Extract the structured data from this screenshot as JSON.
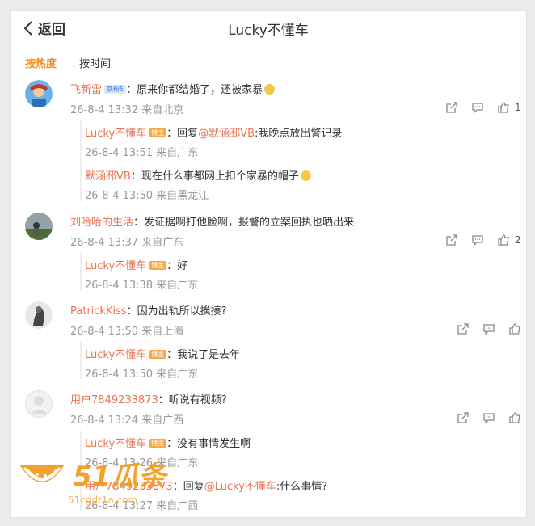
{
  "header": {
    "back_label": "返回",
    "title": "Lucky不懂车"
  },
  "tabs": [
    {
      "label": "按热度",
      "active": true
    },
    {
      "label": "按时间",
      "active": false
    }
  ],
  "comments": [
    {
      "user": "飞新雷",
      "badge": "铁粉5",
      "text": "：原来你都结婚了，还被家暴",
      "meta": "26-8-4 13:32 来自北京",
      "likes": "1",
      "replies": [
        {
          "user": "Lucky不懂车",
          "badge": "博主",
          "prefix": "：回复",
          "mention": "@默涵邳VB",
          "text": ":我晚点放出警记录",
          "meta": "26-8-4 13:51 来自广东"
        },
        {
          "user": "默涵邳VB",
          "badge": "",
          "prefix": "：现在什么事都网上扣个家暴的帽子",
          "mention": "",
          "text": "",
          "meta": "26-8-4 13:50 来自黑龙江"
        }
      ]
    },
    {
      "user": "刘哈哈的生活",
      "badge": "",
      "text": "：发证据啊打他脸啊，报警的立案回执也晒出来",
      "meta": "26-8-4 13:37 来自广东",
      "likes": "2",
      "replies": [
        {
          "user": "Lucky不懂车",
          "badge": "博主",
          "prefix": "：好",
          "mention": "",
          "text": "",
          "meta": "26-8-4 13:38 来自广东"
        }
      ]
    },
    {
      "user": "PatrickKiss",
      "badge": "",
      "text": "：因为出轨所以挨揍?",
      "meta": "26-8-4 13:50 来自上海",
      "likes": "",
      "replies": [
        {
          "user": "Lucky不懂车",
          "badge": "博主",
          "prefix": "：我说了是去年",
          "mention": "",
          "text": "",
          "meta": "26-8-4 13:50 来自广东"
        }
      ]
    },
    {
      "user": "用户7849233873",
      "badge": "",
      "text": "：听说有视频?",
      "meta": "26-8-4 13:24 来自广西",
      "likes": "",
      "replies": [
        {
          "user": "Lucky不懂车",
          "badge": "博主",
          "prefix": "：没有事情发生啊",
          "mention": "",
          "text": "",
          "meta": "26-8-4 13:26 来自广东"
        },
        {
          "user": "用户7849233873",
          "badge": "",
          "prefix": "：回复",
          "mention": "@Lucky不懂车",
          "text": ":什么事情?",
          "meta": "26-8-4 13:27 来自广西"
        }
      ]
    }
  ],
  "watermark": {
    "text": "51瓜条",
    "url": "51cgdt1a.com"
  },
  "colors": {
    "accent": "#f28a22",
    "name": "#eb7350",
    "meta": "#999999"
  }
}
